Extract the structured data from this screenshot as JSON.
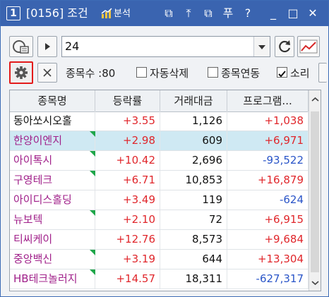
{
  "title": {
    "number": "1",
    "code": "[0156] 조건",
    "analysis": "분석"
  },
  "title_icons": [
    "restore-window-icon",
    "pin-top-icon",
    "copy-window-icon",
    "pin-icon",
    "help-icon",
    "minimize-icon",
    "maximize-icon",
    "close-icon"
  ],
  "title_icon_glyphs": [
    "⧉",
    "⤒",
    "⧉",
    "푸",
    "?",
    "_",
    "□",
    "✕"
  ],
  "toolbar": {
    "condition_value": "24"
  },
  "options": {
    "count_label": "종목수 :80",
    "auto_delete_label": "자동삭제",
    "stock_link_label": "종목연동",
    "sound_label": "소리",
    "auto_delete_checked": false,
    "stock_link_checked": false,
    "sound_checked": true
  },
  "table": {
    "columns": [
      "종목명",
      "등락률",
      "거래대금",
      "프로그램..."
    ],
    "rows": [
      {
        "name": "동아쏘시오홀",
        "rate": "+3.55",
        "volume": "1,126",
        "program": "+1,038",
        "name_color": "#111111",
        "program_color": "#e0262b",
        "flag": false,
        "selected": false
      },
      {
        "name": "한양이엔지",
        "rate": "+2.98",
        "volume": "609",
        "program": "+6,971",
        "name_color": "#a0208a",
        "program_color": "#e0262b",
        "flag": true,
        "selected": true
      },
      {
        "name": "아이톡시",
        "rate": "+10.42",
        "volume": "2,696",
        "program": "-93,522",
        "name_color": "#a0208a",
        "program_color": "#2a55c8",
        "flag": true,
        "selected": false
      },
      {
        "name": "구영테크",
        "rate": "+6.71",
        "volume": "10,853",
        "program": "+16,879",
        "name_color": "#a0208a",
        "program_color": "#e0262b",
        "flag": true,
        "selected": false
      },
      {
        "name": "아이디스홀딩",
        "rate": "+3.49",
        "volume": "119",
        "program": "-624",
        "name_color": "#a0208a",
        "program_color": "#2a55c8",
        "flag": false,
        "selected": false
      },
      {
        "name": "뉴보텍",
        "rate": "+2.10",
        "volume": "72",
        "program": "+6,915",
        "name_color": "#a0208a",
        "program_color": "#e0262b",
        "flag": true,
        "selected": false
      },
      {
        "name": "티씨케이",
        "rate": "+12.76",
        "volume": "8,573",
        "program": "+9,684",
        "name_color": "#a0208a",
        "program_color": "#e0262b",
        "flag": false,
        "selected": false
      },
      {
        "name": "중앙백신",
        "rate": "+3.19",
        "volume": "644",
        "program": "+13,304",
        "name_color": "#a0208a",
        "program_color": "#e0262b",
        "flag": true,
        "selected": false
      },
      {
        "name": "HB테크놀러지",
        "rate": "+14.57",
        "volume": "18,311",
        "program": "-627,317",
        "name_color": "#a0208a",
        "program_color": "#2a55c8",
        "flag": true,
        "selected": false
      }
    ]
  },
  "colors": {
    "title_bar": "#3a64b0",
    "rate_up": "#e0262b",
    "selected_row": "#cfe9f3",
    "settings_highlight": "#e31b1b"
  }
}
